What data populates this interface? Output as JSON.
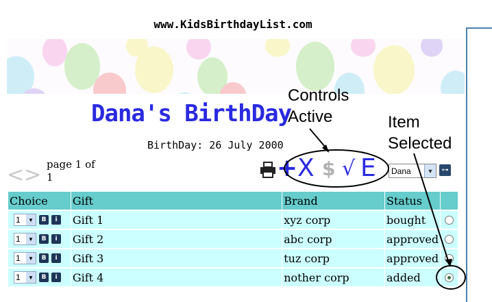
{
  "site": {
    "url": "www.KidsBirthdayList.com"
  },
  "page": {
    "title": "Dana's BirthDay",
    "birthday": "BirthDay: 26 July 2000"
  },
  "pager": {
    "prev": "<",
    "next": ">",
    "line1": "page 1 of",
    "line2": "1"
  },
  "toolbar": {
    "add": "+",
    "delete": "X",
    "price": "$",
    "approve": "√",
    "edit": "E",
    "user_value": "Dana",
    "go": "⊶"
  },
  "annotations": {
    "controls_line1": "Controls",
    "controls_line2": "Active",
    "item_line1": "Item",
    "item_line2": "Selected"
  },
  "table": {
    "headers": [
      "Choice",
      "Gift",
      "Brand",
      "Status"
    ],
    "rows": [
      {
        "qty": "1",
        "gift": "Gift 1",
        "brand": "xyz corp",
        "status": "bought",
        "selected": false
      },
      {
        "qty": "1",
        "gift": "Gift 2",
        "brand": "abc corp",
        "status": "approved",
        "selected": false
      },
      {
        "qty": "1",
        "gift": "Gift 3",
        "brand": "tuz corp",
        "status": "approved",
        "selected": false
      },
      {
        "qty": "1",
        "gift": "Gift 4",
        "brand": "nother corp",
        "status": "added",
        "selected": true
      }
    ],
    "info_icon_b": "B",
    "info_icon_i": "i"
  },
  "colors": {
    "header_bg": "#66cccc",
    "row_bg": "#ccffff",
    "title": "#2a2ae0",
    "accent_dark": "#27466b"
  }
}
